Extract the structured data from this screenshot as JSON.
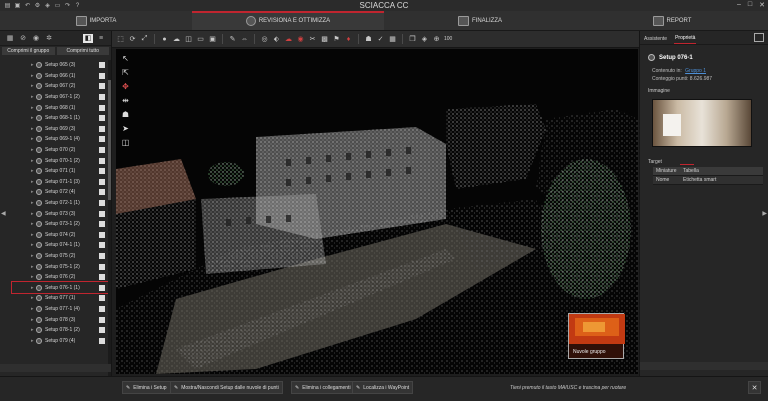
{
  "app": {
    "title": "SCIACCA CC",
    "window_controls": [
      "‒",
      "□",
      "✕"
    ],
    "quick_icons": [
      "open-icon",
      "save-icon",
      "undo-icon",
      "settings-icon",
      "layers-icon",
      "folder-icon",
      "redo-icon",
      "help-icon"
    ]
  },
  "steps": [
    {
      "label": "IMPORTA",
      "active": false
    },
    {
      "label": "REVISIONA E OTTIMIZZA",
      "active": true
    },
    {
      "label": "FINALIZZA",
      "active": false
    },
    {
      "label": "REPORT",
      "active": false
    }
  ],
  "left_panel": {
    "collapse_all": "Comprimi il gruppo",
    "expand_all": "Comprimi tutto",
    "setups": [
      {
        "label": "Setup 065 (3)"
      },
      {
        "label": "Setup 066 (1)"
      },
      {
        "label": "Setup 067 (2)"
      },
      {
        "label": "Setup 067-1 (2)"
      },
      {
        "label": "Setup 068 (1)"
      },
      {
        "label": "Setup 068-1 (1)"
      },
      {
        "label": "Setup 069 (3)"
      },
      {
        "label": "Setup 069-1 (4)"
      },
      {
        "label": "Setup 070 (2)"
      },
      {
        "label": "Setup 070-1 (2)"
      },
      {
        "label": "Setup 071 (1)"
      },
      {
        "label": "Setup 071-1 (3)"
      },
      {
        "label": "Setup 072 (4)"
      },
      {
        "label": "Setup 072-1 (1)"
      },
      {
        "label": "Setup 073 (3)"
      },
      {
        "label": "Setup 073-1 (2)"
      },
      {
        "label": "Setup 074 (2)"
      },
      {
        "label": "Setup 074-1 (1)"
      },
      {
        "label": "Setup 075 (2)"
      },
      {
        "label": "Setup 075-1 (2)"
      },
      {
        "label": "Setup 076 (2)"
      },
      {
        "label": "Setup 076-1 (1)"
      },
      {
        "label": "Setup 077 (1)"
      },
      {
        "label": "Setup 077-1 (4)"
      },
      {
        "label": "Setup 078 (3)"
      },
      {
        "label": "Setup 078-1 (2)"
      },
      {
        "label": "Setup 079 (4)"
      }
    ]
  },
  "main_toolbar": {
    "icons": [
      "select-icon",
      "rotate-icon",
      "fit-icon",
      "sep",
      "sphere-icon",
      "cloud-icon",
      "cube-icon",
      "plane-icon",
      "box-icon",
      "sep",
      "pencil-icon",
      "measure-icon",
      "sep",
      "target-icon",
      "tag-icon",
      "cloud-filter-icon",
      "eye-icon",
      "scissors-icon",
      "camera-icon",
      "pin-icon",
      "marker-icon",
      "sep",
      "person-icon",
      "check-icon",
      "grid-icon",
      "sep",
      "cube-view-icon",
      "layers-icon",
      "zoom-icon"
    ],
    "zoom_value": "100"
  },
  "viewport": {
    "mini_label": "Nuvole gruppo"
  },
  "right_panel": {
    "tabs": [
      "Assistente",
      "Proprietà"
    ],
    "active_tab": 1,
    "setup_title": "Setup 076-1",
    "contained_label": "Contenuto in:",
    "contained_value": "Gruppo 1",
    "points_label": "Conteggio punti: 8.626.987",
    "image_section": "Immagine",
    "target_section": "Target",
    "table": {
      "headers": [
        "Miniature",
        "Tabella"
      ],
      "row": [
        "Nome",
        "Etichetta smart"
      ]
    }
  },
  "bottom_bar": {
    "buttons": [
      "Elimina i Setup",
      "Mostra/Nascondi Setup dalle nuvole di punti",
      "Elimina i collegamenti",
      "Localizza i WayPoint"
    ],
    "hint": "Tieni premuto il tasto MAIUSC e trascina per ruotare",
    "close": "✕"
  }
}
